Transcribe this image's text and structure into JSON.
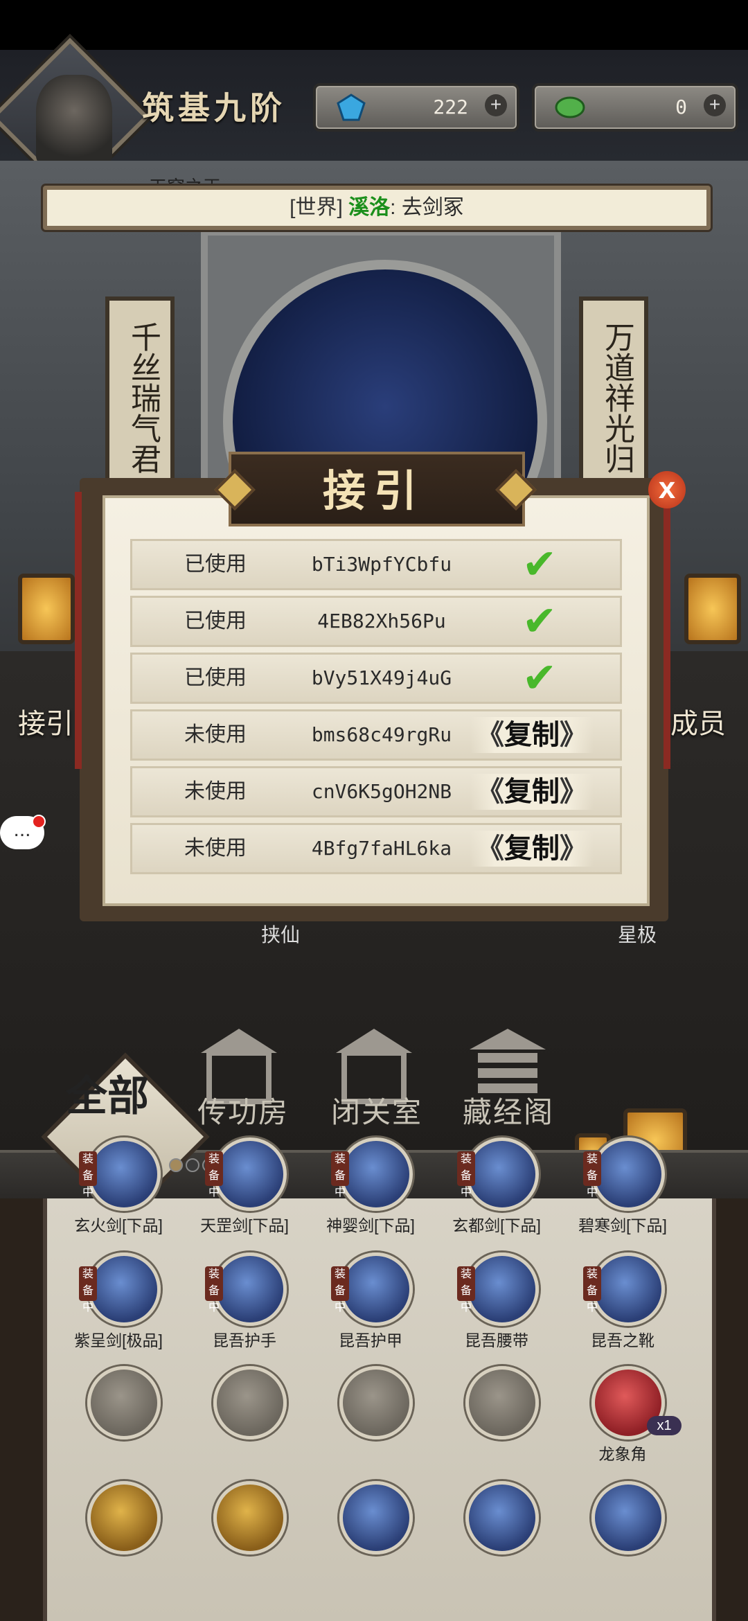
{
  "header": {
    "realm": "筑基九阶",
    "currency_1": {
      "icon": "blue-crystal-icon",
      "value": "222"
    },
    "currency_2": {
      "icon": "green-jade-icon",
      "value": "0"
    }
  },
  "ticker": {
    "channel": "[世界]",
    "name": "溪洛",
    "separator": ":",
    "message": "去剑冢",
    "partial_text": "天穹之王"
  },
  "scene": {
    "left_couplet": "千丝瑞气君",
    "right_couplet": "万道祥光归",
    "left_side_button": "接引",
    "right_side_button": "成员",
    "chat_icon": "..."
  },
  "dialog": {
    "title": "接引",
    "close_icon": "x",
    "copy_label": "复制",
    "rows": [
      {
        "status": "已使用",
        "code": "bTi3WpfYCbfu",
        "used": true
      },
      {
        "status": "已使用",
        "code": "4EB82Xh56Pu",
        "used": true
      },
      {
        "status": "已使用",
        "code": "bVy51X49j4uG",
        "used": true
      },
      {
        "status": "未使用",
        "code": "bms68c49rgRu",
        "used": false
      },
      {
        "status": "未使用",
        "code": "cnV6K5gOH2NB",
        "used": false
      },
      {
        "status": "未使用",
        "code": "4Bfg7faHL6ka",
        "used": false
      }
    ],
    "behind_labels": [
      "挟仙",
      "星极"
    ]
  },
  "nav": {
    "all_tab": "全部",
    "buildings": [
      "传功房",
      "闭关室",
      "藏经阁"
    ]
  },
  "inventory": {
    "equip_tag": "装备中",
    "rows": [
      [
        {
          "label": "玄火剑[下品]",
          "equipped": true,
          "color": "blue"
        },
        {
          "label": "天罡剑[下品]",
          "equipped": true,
          "color": "blue"
        },
        {
          "label": "神婴剑[下品]",
          "equipped": true,
          "color": "blue"
        },
        {
          "label": "玄都剑[下品]",
          "equipped": true,
          "color": "blue"
        },
        {
          "label": "碧寒剑[下品]",
          "equipped": true,
          "color": "blue"
        }
      ],
      [
        {
          "label": "紫呈剑[极品]",
          "equipped": true,
          "color": "blue"
        },
        {
          "label": "昆吾护手",
          "equipped": true,
          "color": "blue"
        },
        {
          "label": "昆吾护甲",
          "equipped": true,
          "color": "blue"
        },
        {
          "label": "昆吾腰带",
          "equipped": true,
          "color": "blue"
        },
        {
          "label": "昆吾之靴",
          "equipped": true,
          "color": "blue"
        }
      ],
      [
        {
          "label": "",
          "equipped": false,
          "color": "gray"
        },
        {
          "label": "",
          "equipped": false,
          "color": "gray"
        },
        {
          "label": "",
          "equipped": false,
          "color": "gray"
        },
        {
          "label": "",
          "equipped": false,
          "color": "gray"
        },
        {
          "label": "龙象角",
          "equipped": false,
          "color": "red",
          "qty": "x1"
        }
      ],
      [
        {
          "label": "",
          "equipped": false,
          "color": "gold"
        },
        {
          "label": "",
          "equipped": false,
          "color": "gold"
        },
        {
          "label": "",
          "equipped": false,
          "color": "blue"
        },
        {
          "label": "",
          "equipped": false,
          "color": "blue"
        },
        {
          "label": "",
          "equipped": false,
          "color": "blue"
        }
      ]
    ]
  }
}
